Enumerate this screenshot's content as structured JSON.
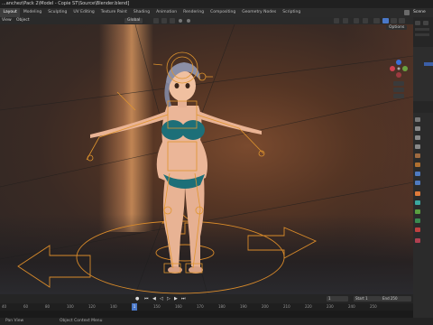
{
  "window": {
    "title": "...anchez\\Pack 2\\Model - Copie ST\\Source\\Blender.blend]"
  },
  "workspaces": [
    "Layout",
    "Modeling",
    "Sculpting",
    "UV Editing",
    "Texture Paint",
    "Shading",
    "Animation",
    "Rendering",
    "Compositing",
    "Geometry Nodes",
    "Scripting"
  ],
  "active_workspace": "Layout",
  "scene_label": "Scene",
  "viewport_header": {
    "view": "View",
    "object_menu": "Object",
    "orientation": "Global",
    "options": "Options"
  },
  "timeline": {
    "current_frame": "1",
    "start_label": "Start",
    "start": "1",
    "end_label": "End",
    "end": "250"
  },
  "ruler_ticks": [
    "40",
    "60",
    "80",
    "100",
    "120",
    "140",
    "150",
    "160",
    "170",
    "180",
    "190",
    "200",
    "210",
    "220",
    "230",
    "240",
    "250"
  ],
  "playhead": "1",
  "status": {
    "left": "Pan View",
    "middle": "Object Context Menu"
  },
  "colors": {
    "accent": "#4a78c8",
    "rig": "#e0952e",
    "bikini": "#1d6f78"
  }
}
